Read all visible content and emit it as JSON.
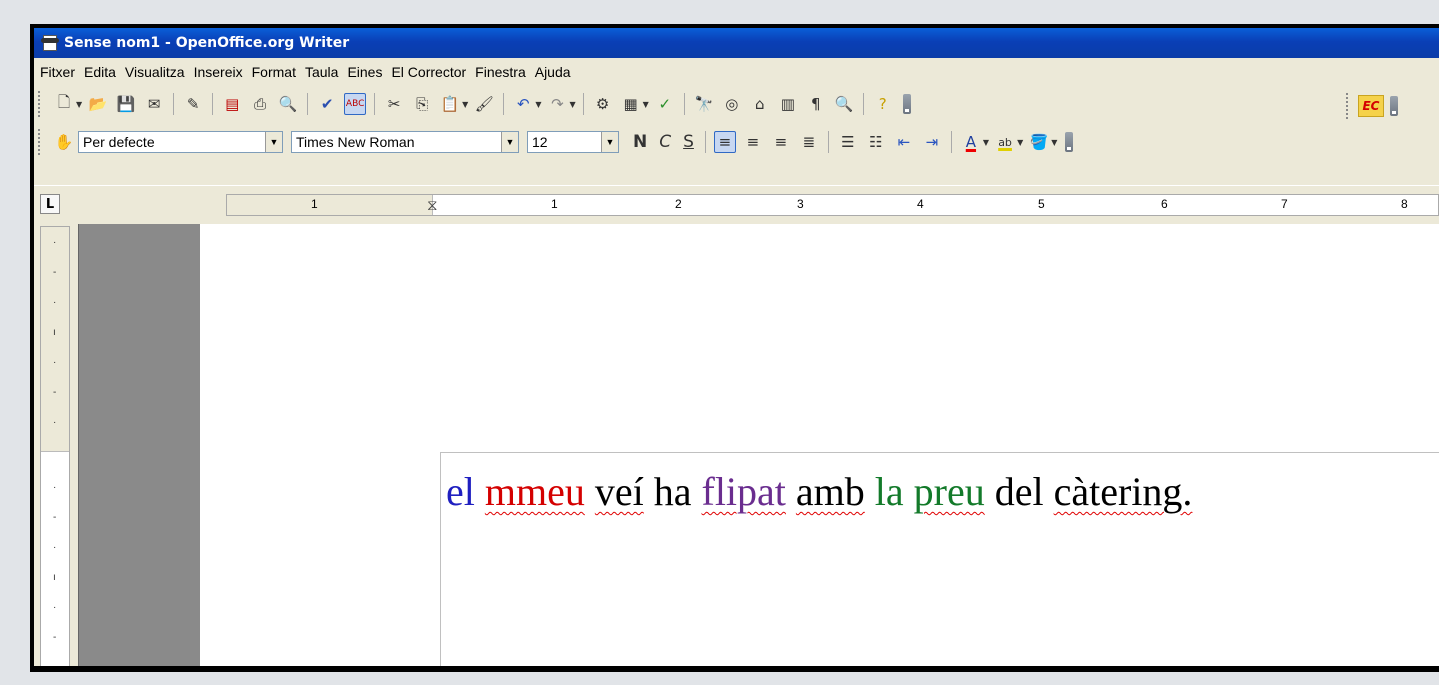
{
  "window": {
    "title": "Sense nom1 - OpenOffice.org Writer"
  },
  "menu": [
    "Fitxer",
    "Edita",
    "Visualitza",
    "Insereix",
    "Format",
    "Taula",
    "Eines",
    "El Corrector",
    "Finestra",
    "Ajuda"
  ],
  "standard_toolbar": {
    "icons": [
      "new-icon",
      "open-icon",
      "save-icon",
      "email-icon",
      "edit-file-icon",
      "export-pdf-icon",
      "print-icon",
      "page-preview-icon",
      "spellcheck-icon",
      "autospellcheck-icon",
      "cut-icon",
      "copy-icon",
      "paste-icon",
      "format-paintbrush-icon",
      "undo-icon",
      "redo-icon",
      "navigator-icon",
      "table-icon",
      "draw-functions-icon",
      "find-replace-icon",
      "navigator-compass-icon",
      "gallery-icon",
      "data-sources-icon",
      "formatting-marks-icon",
      "zoom-icon",
      "help-icon"
    ],
    "extension_label": "EC"
  },
  "format_toolbar": {
    "paragraph_style": "Per defecte",
    "font_name": "Times New Roman",
    "font_size": "12",
    "bold_label": "N",
    "italic_label": "C",
    "underline_label": "S"
  },
  "ruler": {
    "numbers": [
      "1",
      "1",
      "2",
      "3",
      "4",
      "5",
      "6",
      "7",
      "8"
    ]
  },
  "document": {
    "words": [
      {
        "text": "el",
        "color": "#1f1fc0",
        "error": false
      },
      {
        "text": "mmeu",
        "color": "#d40000",
        "error": true
      },
      {
        "text": "veí",
        "color": "#000000",
        "error": true
      },
      {
        "text": "ha",
        "color": "#000000",
        "error": false
      },
      {
        "text": "flipat",
        "color": "#6a2d8f",
        "error": true
      },
      {
        "text": "amb",
        "color": "#000000",
        "error": true
      },
      {
        "text": "la",
        "color": "#137a2a",
        "error": false
      },
      {
        "text": "preu",
        "color": "#137a2a",
        "error": true
      },
      {
        "text": "del",
        "color": "#000000",
        "error": false
      },
      {
        "text": "càtering.",
        "color": "#000000",
        "error": true
      }
    ]
  }
}
